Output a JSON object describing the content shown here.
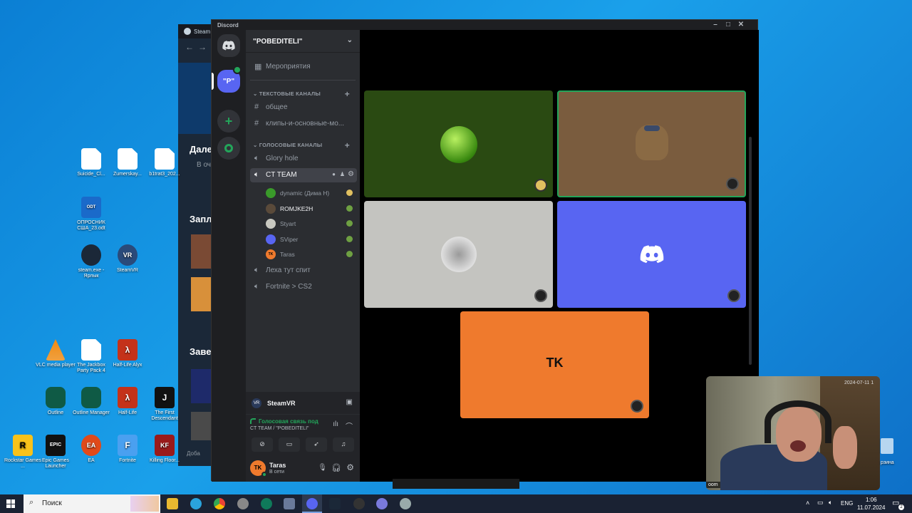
{
  "desktop": {
    "icons": [
      {
        "label": "Suicide_Cl...",
        "kind": "file"
      },
      {
        "label": "Zumerskay...",
        "kind": "file"
      },
      {
        "label": "b1trat3_202...",
        "kind": "file"
      },
      {
        "label": "ОПРОСНИК США_23.odt",
        "kind": "odt",
        "badge": "ODT"
      },
      {
        "label": "steam.exe - Ярлык",
        "kind": "steam"
      },
      {
        "label": "SteamVR",
        "kind": "vr",
        "badge": "VR"
      },
      {
        "label": "VLC media player",
        "kind": "vlc"
      },
      {
        "label": "The Jackbox Party Pack 4",
        "kind": "file"
      },
      {
        "label": "Half-Life Alyx",
        "kind": "hl",
        "badge": "λ"
      },
      {
        "label": "Outline",
        "kind": "outline"
      },
      {
        "label": "Outline Manager",
        "kind": "outline"
      },
      {
        "label": "Half-Life",
        "kind": "hl",
        "badge": "λ"
      },
      {
        "label": "The First Descendant",
        "kind": "tfd",
        "badge": "J"
      },
      {
        "label": "Rockstar Games ...",
        "kind": "rockstar",
        "badge": "R"
      },
      {
        "label": "Epic Games Launcher",
        "kind": "epic",
        "badge": "EPIC"
      },
      {
        "label": "EA",
        "kind": "ea",
        "badge": "EA"
      },
      {
        "label": "Fortnite",
        "kind": "fortnite",
        "badge": "F"
      },
      {
        "label": "Killing Floor...",
        "kind": "kf",
        "badge": "KF"
      }
    ],
    "recycle_label": "рзина"
  },
  "steam_window": {
    "title": "Steam",
    "texts": [
      "Дале",
      "В оч",
      "Запл",
      "Заве",
      "Доба"
    ]
  },
  "discord": {
    "window_title": "Discord",
    "server_name": "\"POBEDITELI\"",
    "events_label": "Мероприятия",
    "text_category": "ТЕКСТОВЫЕ КАНАЛЫ",
    "text_channels": [
      "общее",
      "клипы-и-основные-мо..."
    ],
    "voice_category": "ГОЛОСОВЫЕ КАНАЛЫ",
    "voice_channels": [
      "Glory hole",
      "CT TEAM",
      "Леха тут спит",
      "Fortnite > CS2"
    ],
    "voice_users": [
      {
        "name": "dynamic (Дима Н)",
        "color": "#3a9a2a"
      },
      {
        "name": "ROMJKE2H",
        "color": "#5a4a3a"
      },
      {
        "name": "Styart",
        "color": "#c8c8c0"
      },
      {
        "name": "SViper",
        "color": "#5865f2"
      },
      {
        "name": "Taras",
        "color": "#ef7a2d",
        "initials": "TK"
      }
    ],
    "activity_name": "SteamVR",
    "voice_status": "Голосовая связь под",
    "voice_channel_path": "CT TEAM / \"POBEDITELI\"",
    "user": {
      "name": "Taras",
      "status": "В сети",
      "initials": "TK"
    },
    "server_badge": "\"P\"",
    "stage_tiles": [
      {
        "bg": "#2a4a12",
        "label": ""
      },
      {
        "bg": "#7a5c3e",
        "label": ""
      },
      {
        "bg": "#c4c4c0",
        "label": ""
      },
      {
        "bg": "#5865f2",
        "label": ""
      },
      {
        "bg": "#ef7a2d",
        "label": "TK"
      }
    ]
  },
  "webcam": {
    "overlay_text": "2024-07-11 1",
    "corner": "oom"
  },
  "taskbar": {
    "search_placeholder": "Поиск",
    "lang": "ENG",
    "time": "1:06",
    "date": "11.07.2024",
    "notif_count": "2"
  }
}
